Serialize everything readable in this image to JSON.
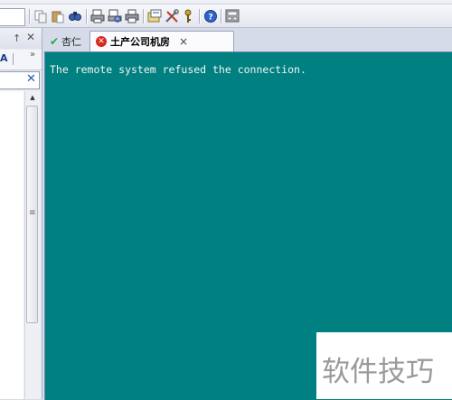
{
  "toolbar": {
    "icons": [
      "copy-icon",
      "paste-icon",
      "find-icon",
      "print-setup-icon",
      "print-preview-icon",
      "print-icon",
      "session-properties-icon",
      "tools-icon",
      "key-icon",
      "help-icon",
      "screen-icon"
    ]
  },
  "left_panel": {
    "pin_glyph": "↑",
    "close_glyph": "✕",
    "font_glyph": "A",
    "more_glyph": "»",
    "search_clear_glyph": "✕",
    "scroll_up_glyph": "▲",
    "thumb_grip_glyph": "≡"
  },
  "tabs": [
    {
      "label": "杏仁",
      "status": "connected"
    },
    {
      "label": "土产公司机房",
      "status": "error",
      "close": "×"
    }
  ],
  "terminal": {
    "output": "The remote system refused the connection.",
    "background": "#008080",
    "foreground": "#f4f4f4"
  },
  "watermark": {
    "text": "软件技巧"
  }
}
